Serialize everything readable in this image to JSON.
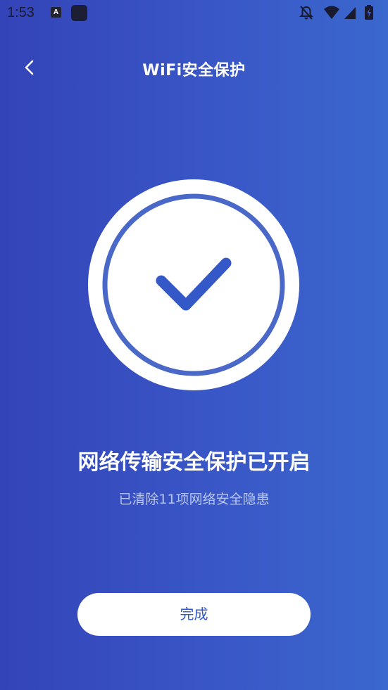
{
  "status_bar": {
    "time": "1:53",
    "app_icon_letter": "A",
    "icons": [
      "text-app-icon",
      "app-square-icon",
      "notifications-off-icon",
      "wifi-icon",
      "signal-icon",
      "battery-icon"
    ]
  },
  "nav": {
    "back_icon": "chevron-left-icon",
    "title": "WiFi安全保护"
  },
  "badge": {
    "icon": "checkmark-icon",
    "colors": {
      "outer": "#ffffff",
      "ring": "#4a68c8",
      "check": "#3458c8"
    }
  },
  "result": {
    "title": "网络传输安全保护已开启",
    "subtitle": "已清除11项网络安全隐患"
  },
  "actions": {
    "done_label": "完成"
  },
  "colors": {
    "background_start": "#3344b8",
    "background_end": "#3a68cc",
    "button_text": "#2f58c8",
    "subtitle_text": "#b9c6f0"
  }
}
